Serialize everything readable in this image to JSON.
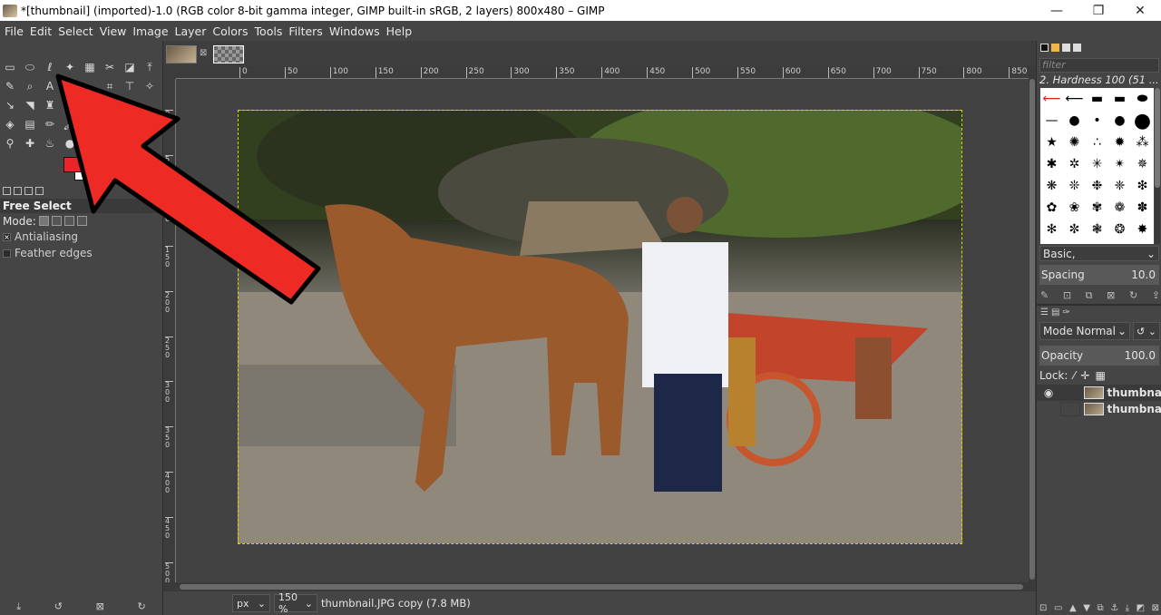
{
  "window": {
    "title": "*[thumbnail] (imported)-1.0 (RGB color 8-bit gamma integer, GIMP built-in sRGB, 2 layers) 800x480 – GIMP",
    "minimize": "—",
    "maximize": "❐",
    "close": "✕"
  },
  "menu": [
    "File",
    "Edit",
    "Select",
    "View",
    "Image",
    "Layer",
    "Colors",
    "Tools",
    "Filters",
    "Windows",
    "Help"
  ],
  "tool_options": {
    "title": "Free Select",
    "mode_label": "Mode:",
    "antialiasing": "Antialiasing",
    "antialiasing_checked": true,
    "feather_edges": "Feather edges",
    "feather_checked": false
  },
  "colors": {
    "foreground": "#e8262a",
    "background": "#ffffff",
    "selection_marquee": "#d8d800",
    "arrow": "#ee2a24"
  },
  "hruler": [
    "0",
    "50",
    "100",
    "150",
    "200",
    "250",
    "300",
    "350",
    "400",
    "450",
    "500",
    "550",
    "600",
    "650",
    "700",
    "750",
    "800",
    "850"
  ],
  "vruler": [
    "0",
    "50",
    "100",
    "150",
    "200",
    "250",
    "300",
    "350",
    "400",
    "450",
    "500"
  ],
  "status": {
    "unit": "px",
    "zoom": "150 %",
    "file_info": "thumbnail.JPG copy (7.8 MB)"
  },
  "brushes": {
    "filter_placeholder": "filter",
    "selected": "2. Hardness 100 (51 ...",
    "preset": "Basic,",
    "spacing_label": "Spacing",
    "spacing_value": "10.0"
  },
  "layers": {
    "mode_label": "Mode",
    "mode_value": "Normal",
    "opacity_label": "Opacity",
    "opacity_value": "100.0",
    "lock_label": "Lock:",
    "items": [
      {
        "name": "thumbna",
        "visible": true
      },
      {
        "name": "thumbna",
        "visible": false
      }
    ]
  }
}
